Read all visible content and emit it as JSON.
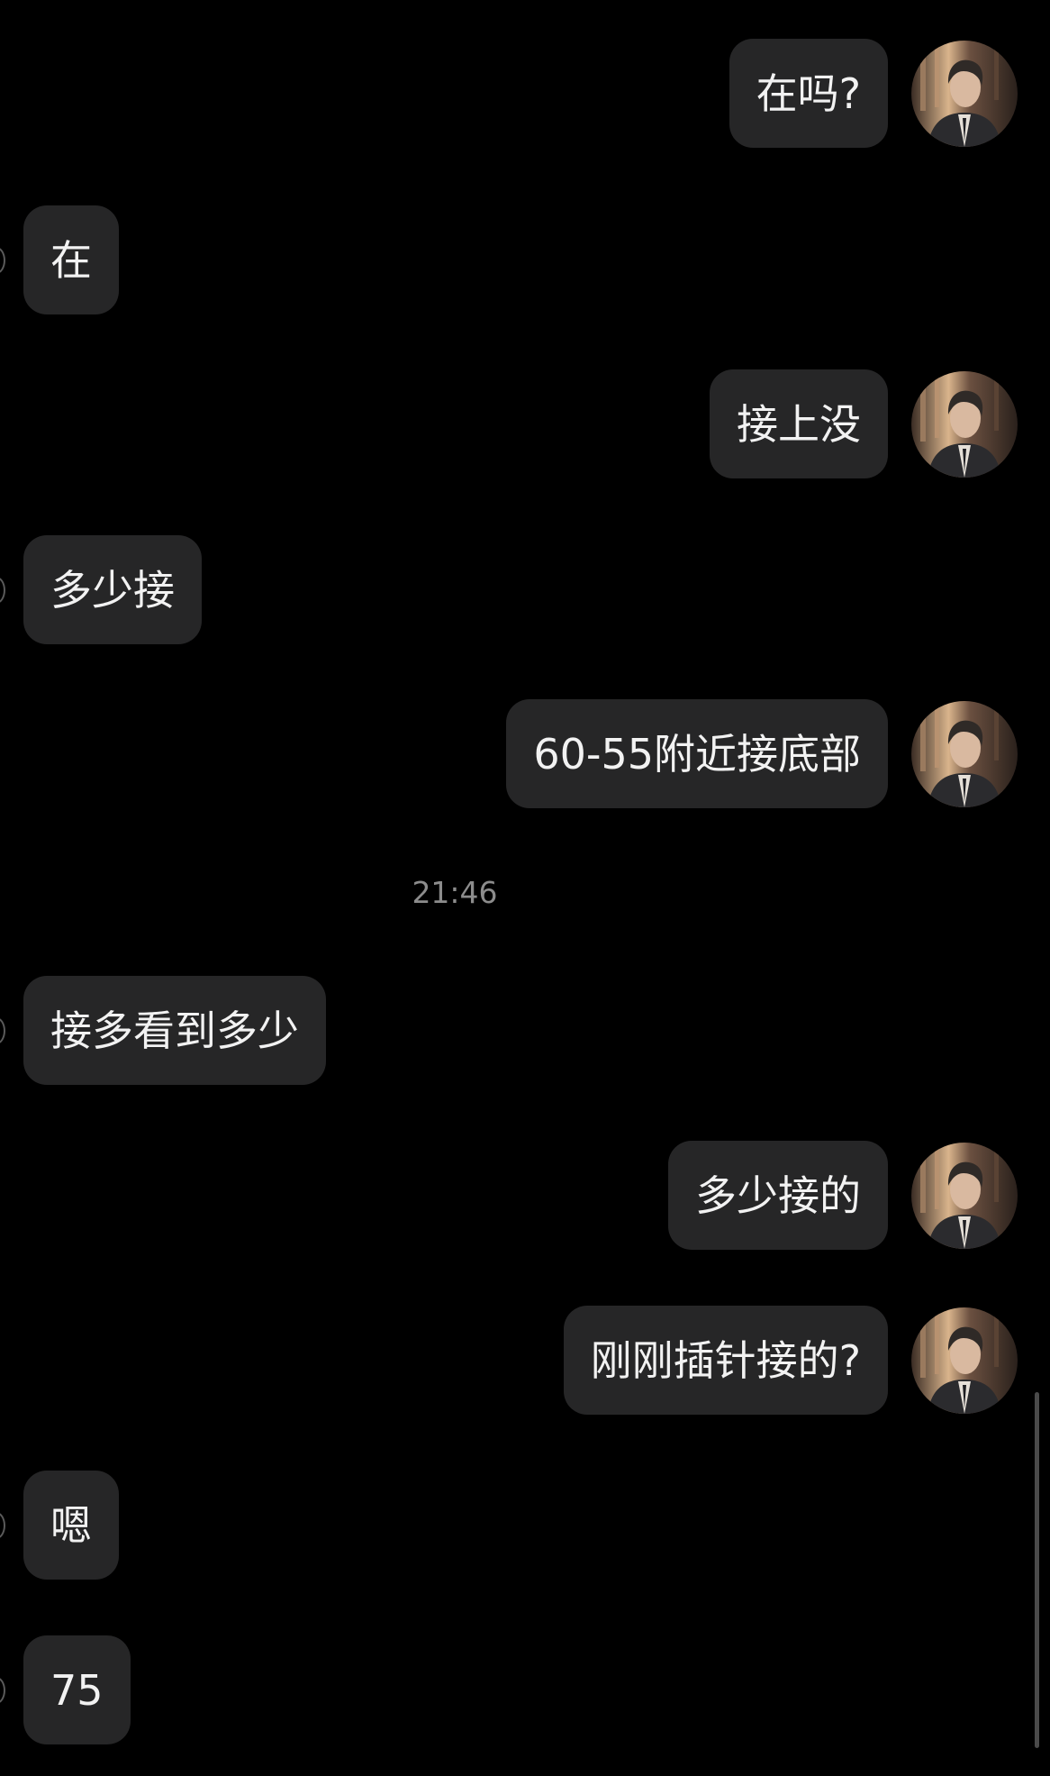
{
  "messages": [
    {
      "side": "out",
      "text": "在吗?"
    },
    {
      "side": "in",
      "text": "在"
    },
    {
      "side": "out",
      "text": "接上没"
    },
    {
      "side": "in",
      "text": "多少接"
    },
    {
      "side": "out",
      "text": "60-55附近接底部"
    },
    {
      "side": "in",
      "text": "接多看到多少"
    },
    {
      "side": "out",
      "text": "多少接的"
    },
    {
      "side": "out",
      "text": "刚刚插针接的?"
    },
    {
      "side": "in",
      "text": "嗯"
    },
    {
      "side": "in",
      "text": "75"
    }
  ],
  "timestamp": "21:46",
  "avatar": {
    "icon": "user-avatar-man-in-suit"
  },
  "colors": {
    "background": "#000000",
    "bubble": "#262627",
    "text": "#f2f2f2",
    "timestamp": "#8c8c8c"
  }
}
